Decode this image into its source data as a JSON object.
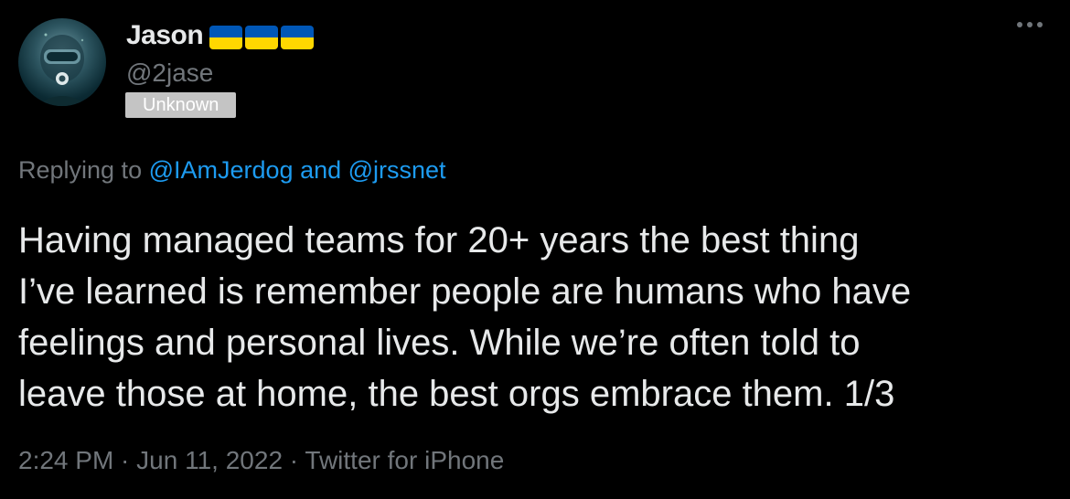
{
  "author": {
    "display_name": "Jason",
    "handle": "@2jase",
    "badge": "Unknown",
    "flag_colors": {
      "top": "#0057b7",
      "bottom": "#ffd700"
    },
    "avatar_icon": "diver-avatar"
  },
  "more_icon": "more-horizontal-icon",
  "reply": {
    "prefix": "Replying to ",
    "mention_1": "@IAmJerdog",
    "joiner": " and ",
    "mention_2": "@jrssnet"
  },
  "tweet": {
    "lines": [
      "Having managed teams for 20+ years the best thing",
      "I’ve learned is remember people are humans who have",
      "feelings and personal lives. While we’re often told to",
      "leave those at home, the best orgs embrace them. 1/3"
    ]
  },
  "meta": {
    "time": "2:24 PM",
    "sep1": " · ",
    "date": "Jun 11, 2022",
    "sep2": " · ",
    "source": "Twitter for iPhone"
  },
  "colors": {
    "background": "#000000",
    "text": "#e7e9ea",
    "muted": "#71767b",
    "link": "#1d9bf0",
    "badge_bg": "#c4c4c4"
  }
}
